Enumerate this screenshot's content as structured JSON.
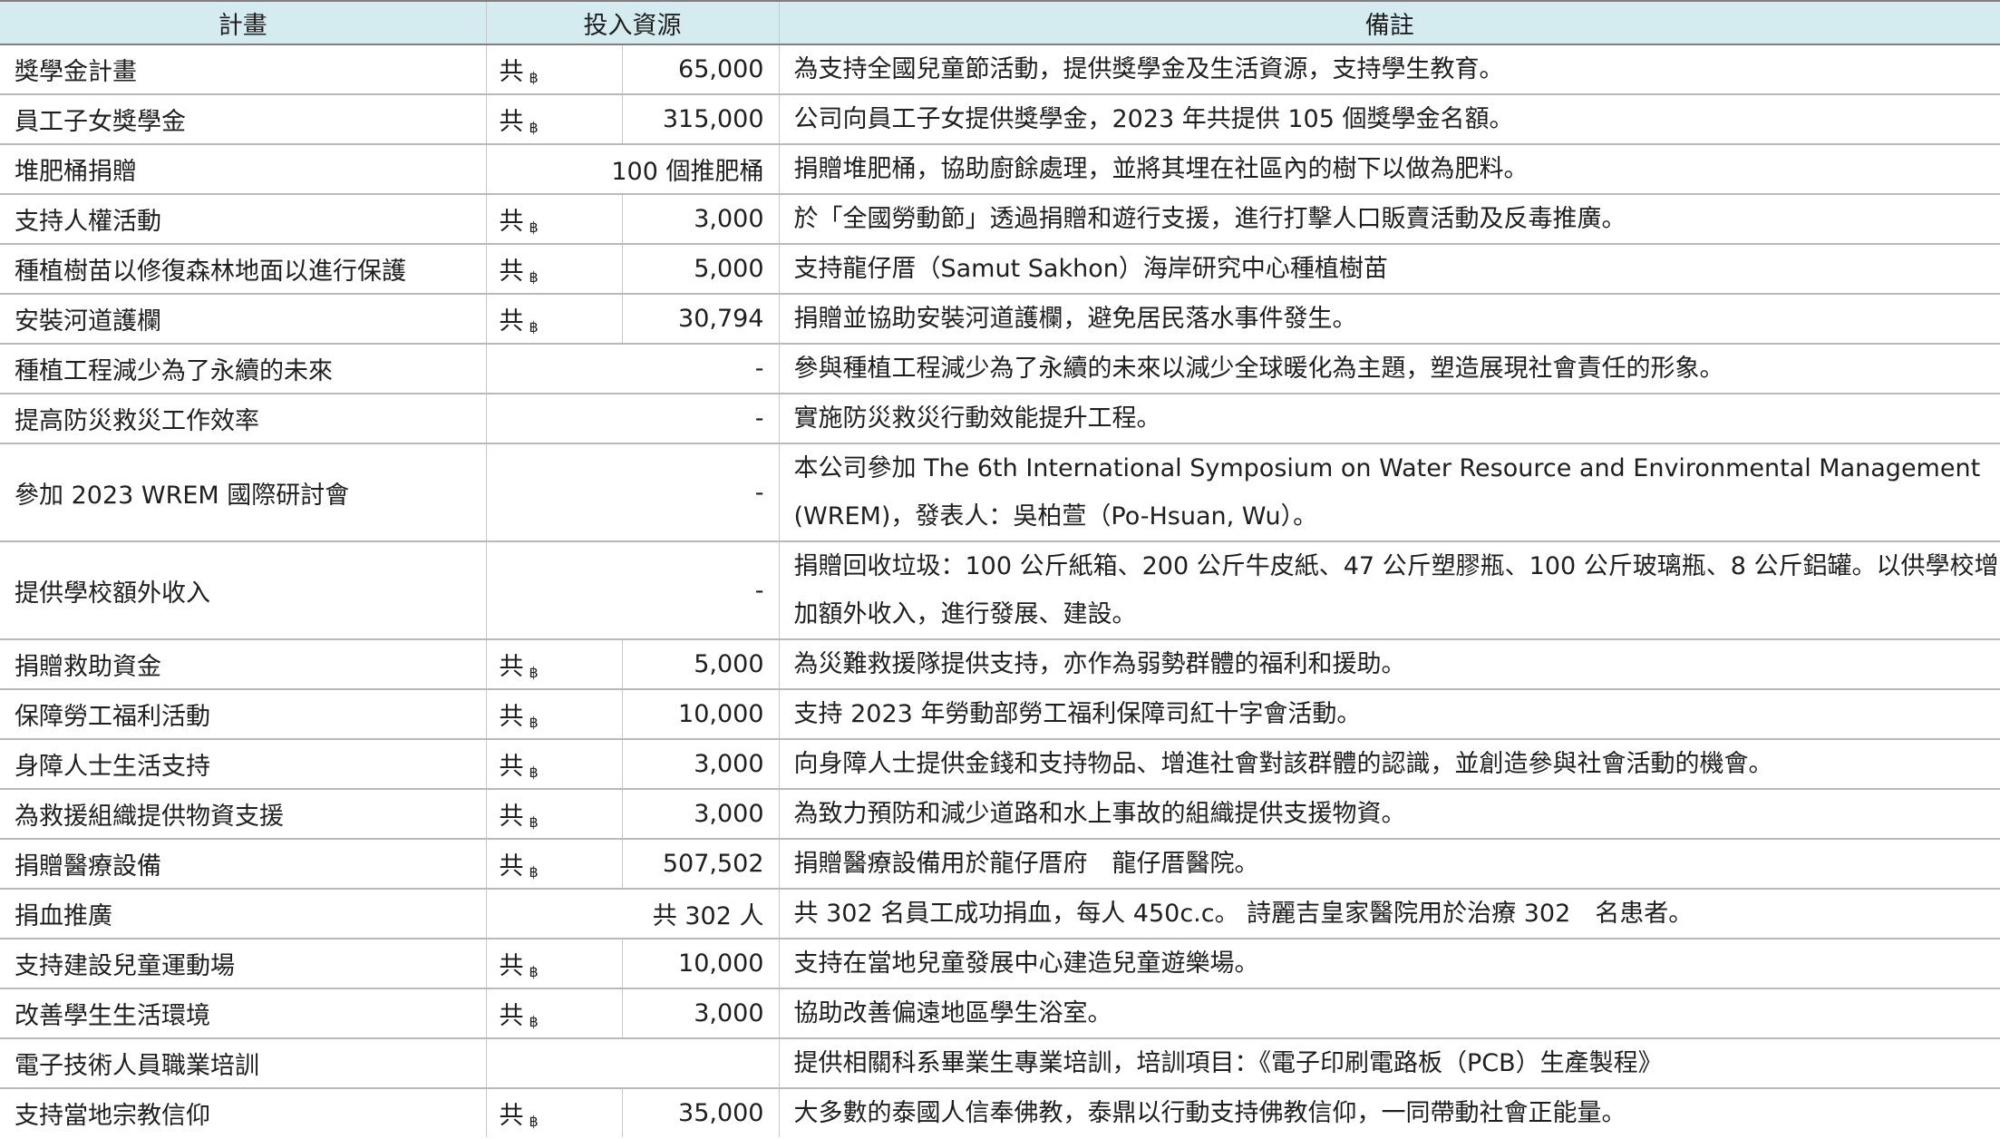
{
  "header": {
    "plan": "計畫",
    "resources": "投入資源",
    "remarks": "備註"
  },
  "rows": [
    {
      "plan": "獎學金計畫",
      "prefix": "共",
      "baht": "฿",
      "amount": "65,000",
      "remark": "為支持全國兒童節活動，提供獎學金及生活資源，支持學生教育。"
    },
    {
      "plan": "員工子女獎學金",
      "prefix": "共",
      "baht": "฿",
      "amount": "315,000",
      "remark": "公司向員工子女提供獎學金，2023 年共提供 105 個獎學金名額。"
    },
    {
      "plan": "堆肥桶捐贈",
      "prefix": "",
      "baht": "",
      "amount": "100 個推肥桶",
      "remark": "捐贈堆肥桶，協助廚餘處理，並將其埋在社區內的樹下以做為肥料。"
    },
    {
      "plan": "支持人權活動",
      "prefix": "共",
      "baht": "฿",
      "amount": "3,000",
      "remark": "於「全國勞動節」透過捐贈和遊行支援，進行打擊人口販賣活動及反毒推廣。"
    },
    {
      "plan": "種植樹苗以修復森林地面以進行保護",
      "prefix": "共",
      "baht": "฿",
      "amount": "5,000",
      "remark": "支持龍仔厝（Samut Sakhon）海岸研究中心種植樹苗"
    },
    {
      "plan": "安裝河道護欄",
      "prefix": "共",
      "baht": "฿",
      "amount": "30,794",
      "remark": "捐贈並協助安裝河道護欄，避免居民落水事件發生。"
    },
    {
      "plan": "種植工程減少為了永續的未來",
      "prefix": "",
      "baht": "",
      "amount": "-",
      "remark": "參與種植工程減少為了永續的未來以減少全球暖化為主題，塑造展現社會責任的形象。"
    },
    {
      "plan": "提高防災救災工作效率",
      "prefix": "",
      "baht": "",
      "amount": "-",
      "remark": "實施防災救災行動效能提升工程。"
    },
    {
      "plan": "參加 2023 WREM 國際研討會",
      "prefix": "",
      "baht": "",
      "amount": "-",
      "remark": "本公司參加 The 6th International Symposium on Water Resource and Environmental Management (WREM)，發表人：吳柏萱（Po-Hsuan, Wu）。",
      "tall": true
    },
    {
      "plan": "提供學校額外收入",
      "prefix": "",
      "baht": "",
      "amount": "-",
      "remark": "捐贈回收垃圾：100 公斤紙箱、200 公斤牛皮紙、47 公斤塑膠瓶、100 公斤玻璃瓶、8 公斤鋁罐。以供學校增加額外收入，進行發展、建設。",
      "tall": true
    },
    {
      "plan": "捐贈救助資金",
      "prefix": "共",
      "baht": "฿",
      "amount": "5,000",
      "remark": "為災難救援隊提供支持，亦作為弱勢群體的福利和援助。"
    },
    {
      "plan": "保障勞工福利活動",
      "prefix": "共",
      "baht": "฿",
      "amount": "10,000",
      "remark": "支持 2023 年勞動部勞工福利保障司紅十字會活動。"
    },
    {
      "plan": "身障人士生活支持",
      "prefix": "共",
      "baht": "฿",
      "amount": "3,000",
      "remark": "向身障人士提供金錢和支持物品、增進社會對該群體的認識，並創造參與社會活動的機會。"
    },
    {
      "plan": "為救援組織提供物資支援",
      "prefix": "共",
      "baht": "฿",
      "amount": "3,000",
      "remark": "為致力預防和減少道路和水上事故的組織提供支援物資。"
    },
    {
      "plan": "捐贈醫療設備",
      "prefix": "共",
      "baht": "฿",
      "amount": "507,502",
      "remark": "捐贈醫療設備用於龍仔厝府　龍仔厝醫院。"
    },
    {
      "plan": "捐血推廣",
      "prefix": "",
      "baht": "",
      "amount": "共 302 人",
      "remark": "共 302 名員工成功捐血，每人 450c.c。 詩麗吉皇家醫院用於治療 302　名患者。"
    },
    {
      "plan": "支持建設兒童運動場",
      "prefix": "共",
      "baht": "฿",
      "amount": "10,000",
      "remark": "支持在當地兒童發展中心建造兒童遊樂場。"
    },
    {
      "plan": "改善學生生活環境",
      "prefix": "共",
      "baht": "฿",
      "amount": "3,000",
      "remark": "協助改善偏遠地區學生浴室。"
    },
    {
      "plan": "電子技術人員職業培訓",
      "prefix": "",
      "baht": "",
      "amount": "",
      "remark": "提供相關科系畢業生專業培訓，培訓項目：《電子印刷電路板（PCB）生產製程》"
    },
    {
      "plan": "支持當地宗教信仰",
      "prefix": "共",
      "baht": "฿",
      "amount": "35,000",
      "remark": "大多數的泰國人信奉佛教，泰鼎以行動支持佛教信仰，一同帶動社會正能量。"
    }
  ]
}
